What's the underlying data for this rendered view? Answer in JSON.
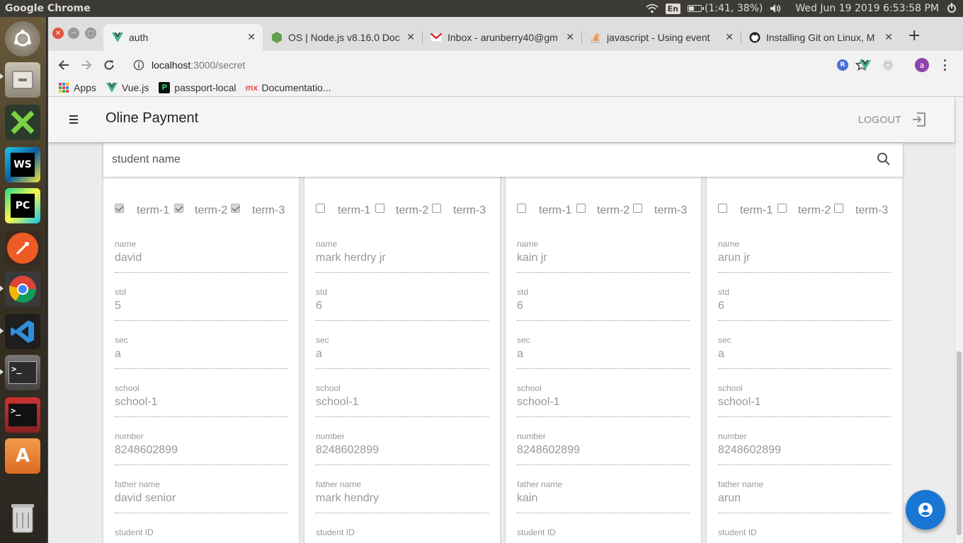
{
  "panel": {
    "app_name": "Google Chrome",
    "keyboard": "En",
    "battery": "(1:41, 38%)",
    "battery_level": 0.38,
    "datetime": "Wed Jun 19 2019  6:53:58 PM"
  },
  "launcher": {
    "items": [
      "ubuntu-dash",
      "files",
      "xmind",
      "webstorm",
      "pycharm",
      "postman",
      "chrome",
      "vscode",
      "terminal",
      "terminal-2",
      "software-center",
      "trash"
    ]
  },
  "tabs": [
    {
      "title": "auth",
      "icon": "vue-icon",
      "active": true
    },
    {
      "title": "OS | Node.js v8.16.0 Doc",
      "icon": "nodejs-icon",
      "active": false
    },
    {
      "title": "Inbox - arunberry40@gm",
      "icon": "gmail-icon",
      "active": false
    },
    {
      "title": "javascript - Using event",
      "icon": "stackoverflow-icon",
      "active": false
    },
    {
      "title": "Installing Git on Linux, M",
      "icon": "github-icon",
      "active": false
    }
  ],
  "address": {
    "host": "localhost",
    "path": ":3000/secret"
  },
  "bookmarks": [
    {
      "label": "Apps",
      "icon": "apps-grid-icon"
    },
    {
      "label": "Vue.js",
      "icon": "vue-icon"
    },
    {
      "label": "passport-local",
      "icon": "passport-icon"
    },
    {
      "label": "Documentatio...",
      "icon": "documentation-icon"
    }
  ],
  "app_bar": {
    "title": "Oline Payment",
    "logout_label": "LOGOUT"
  },
  "search": {
    "placeholder": "student name",
    "value": ""
  },
  "students": [
    {
      "terms": [
        {
          "label": "term-1",
          "checked": true
        },
        {
          "label": "term-2",
          "checked": true
        },
        {
          "label": "term-3",
          "checked": true
        }
      ],
      "fields": [
        {
          "label": "name",
          "value": "david"
        },
        {
          "label": "std",
          "value": "5"
        },
        {
          "label": "sec",
          "value": "a"
        },
        {
          "label": "school",
          "value": "school-1"
        },
        {
          "label": "number",
          "value": "8248602899"
        },
        {
          "label": "father name",
          "value": "david senior"
        },
        {
          "label": "student ID",
          "value": ""
        }
      ]
    },
    {
      "terms": [
        {
          "label": "term-1",
          "checked": false
        },
        {
          "label": "term-2",
          "checked": false
        },
        {
          "label": "term-3",
          "checked": false
        }
      ],
      "fields": [
        {
          "label": "name",
          "value": "mark herdry jr"
        },
        {
          "label": "std",
          "value": "6"
        },
        {
          "label": "sec",
          "value": "a"
        },
        {
          "label": "school",
          "value": "school-1"
        },
        {
          "label": "number",
          "value": "8248602899"
        },
        {
          "label": "father name",
          "value": "mark hendry"
        },
        {
          "label": "student ID",
          "value": ""
        }
      ]
    },
    {
      "terms": [
        {
          "label": "term-1",
          "checked": false
        },
        {
          "label": "term-2",
          "checked": false
        },
        {
          "label": "term-3",
          "checked": false
        }
      ],
      "fields": [
        {
          "label": "name",
          "value": "kain jr"
        },
        {
          "label": "std",
          "value": "6"
        },
        {
          "label": "sec",
          "value": "a"
        },
        {
          "label": "school",
          "value": "school-1"
        },
        {
          "label": "number",
          "value": "8248602899"
        },
        {
          "label": "father name",
          "value": "kain"
        },
        {
          "label": "student ID",
          "value": ""
        }
      ]
    },
    {
      "terms": [
        {
          "label": "term-1",
          "checked": false
        },
        {
          "label": "term-2",
          "checked": false
        },
        {
          "label": "term-3",
          "checked": false
        }
      ],
      "fields": [
        {
          "label": "name",
          "value": "arun jr"
        },
        {
          "label": "std",
          "value": "6"
        },
        {
          "label": "sec",
          "value": "a"
        },
        {
          "label": "school",
          "value": "school-1"
        },
        {
          "label": "number",
          "value": "8248602899"
        },
        {
          "label": "father name",
          "value": "arun"
        },
        {
          "label": "student ID",
          "value": ""
        }
      ]
    }
  ],
  "colors": {
    "primary": "#1976d2",
    "app_bar": "#f5f5f5",
    "page_bg": "#ececec",
    "panel_bg": "#3c3b37"
  }
}
